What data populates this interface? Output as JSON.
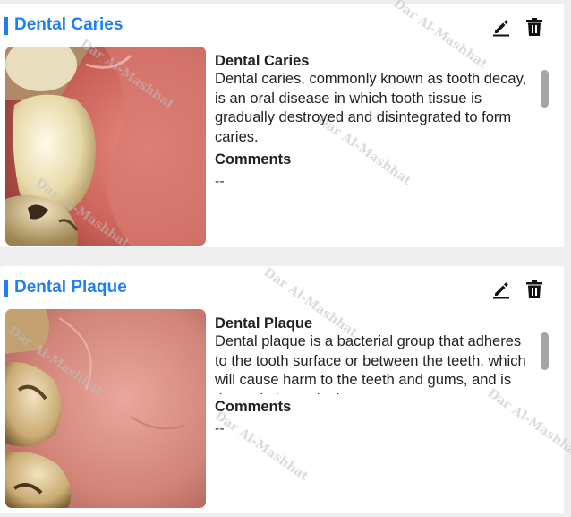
{
  "watermark_text": "Dar Al-Mashhat",
  "cards": [
    {
      "title": "Dental Caries",
      "info_title": "Dental Caries",
      "description": "Dental caries, commonly known as tooth decay, is an oral disease in which tooth tissue is gradually destroyed and disintegrated to form caries.",
      "comments_label": "Comments",
      "comments_value": "--",
      "image_icon": "intraoral-photo-caries"
    },
    {
      "title": "Dental Plaque",
      "info_title": "Dental Plaque",
      "description": "Dental plaque is a bacterial group that adheres to the tooth surface or between the teeth, which will cause harm to the teeth and gums, and is the main bacteria that causes",
      "comments_label": "Comments",
      "comments_value": "--",
      "image_icon": "intraoral-photo-plaque"
    }
  ],
  "icons": {
    "edit": "pencil-icon",
    "delete": "trash-icon"
  },
  "colors": {
    "accent": "#1e7ff0",
    "background": "#efeff1",
    "card": "#ffffff"
  }
}
